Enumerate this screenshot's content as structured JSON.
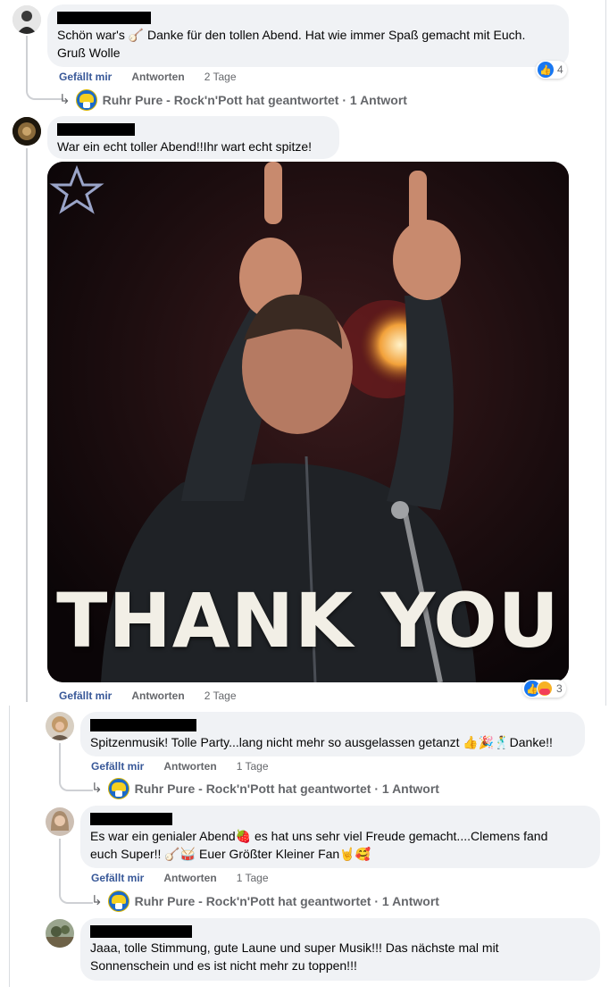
{
  "comments": [
    {
      "text_lines": [
        "Schön war's 🪕 Danke für den tollen Abend. Hat wie immer Spaß gemacht mit Euch.",
        "Gruß Wolle"
      ],
      "like_label": "Gefällt mir",
      "reply_label": "Antworten",
      "time": "2 Tage",
      "reaction_count": "4",
      "page_reply": "Ruhr Pure - Rock'n'Pott hat geantwortet · 1 Antwort"
    },
    {
      "text_lines": [
        "War ein echt toller Abend!!Ihr wart echt spitze!"
      ],
      "gif_caption": "THANK YOU",
      "like_label": "Gefällt mir",
      "reply_label": "Antworten",
      "time": "2 Tage",
      "reaction_count": "3"
    }
  ],
  "replies": [
    {
      "text_lines": [
        "Spitzenmusik! Tolle Party...lang nicht mehr so ausgelassen getanzt 👍🎉🕺Danke!!"
      ],
      "like_label": "Gefällt mir",
      "reply_label": "Antworten",
      "time": "1 Tage",
      "page_reply": "Ruhr Pure - Rock'n'Pott hat geantwortet · 1 Antwort"
    },
    {
      "text_lines": [
        "Es war ein genialer Abend🍓 es hat uns sehr viel Freude gemacht....Clemens fand",
        "euch Super!! 🪕🥁 Euer Größter Kleiner Fan🤘🥰"
      ],
      "like_label": "Gefällt mir",
      "reply_label": "Antworten",
      "time": "1 Tage",
      "page_reply": "Ruhr Pure - Rock'n'Pott hat geantwortet · 1 Antwort"
    },
    {
      "text_lines": [
        "Jaaa, tolle Stimmung, gute Laune und super Musik!!! Das nächste mal mit",
        "Sonnenschein und es ist nicht mehr zu toppen!!!"
      ]
    }
  ],
  "icons": {
    "reply_arrow": "↳",
    "like_thumb": "👍"
  },
  "colors": {
    "bubble": "#f0f2f5",
    "like_link": "#385898",
    "muted": "#65676b",
    "reaction_like": "#1877f2"
  }
}
